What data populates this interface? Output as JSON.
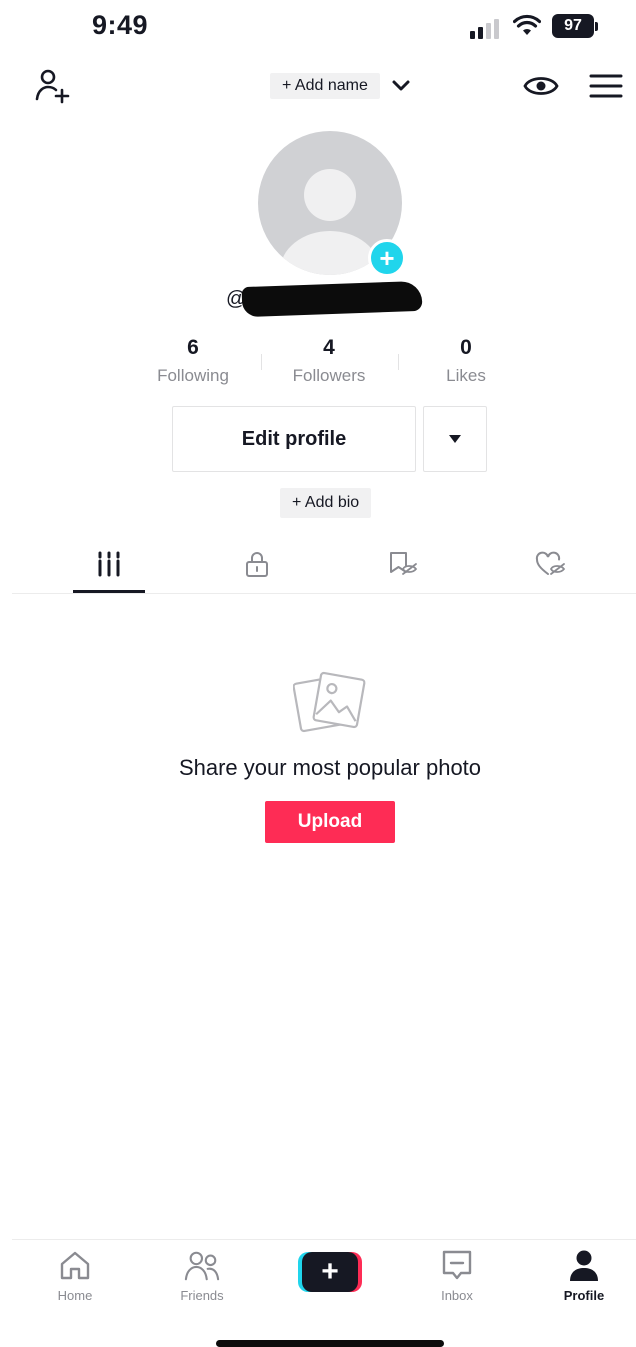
{
  "status_bar": {
    "time": "9:49",
    "battery": "97"
  },
  "header": {
    "add_name_label": "+ Add name"
  },
  "profile": {
    "username_prefix": "@",
    "stats": [
      {
        "value": "6",
        "label": "Following"
      },
      {
        "value": "4",
        "label": "Followers"
      },
      {
        "value": "0",
        "label": "Likes"
      }
    ],
    "edit_profile_label": "Edit profile",
    "add_bio_label": "+ Add bio"
  },
  "tabs": [
    {
      "icon": "grid-icon",
      "active": true
    },
    {
      "icon": "lock-icon",
      "active": false
    },
    {
      "icon": "bookmark-hidden-icon",
      "active": false
    },
    {
      "icon": "heart-hidden-icon",
      "active": false
    }
  ],
  "empty_state": {
    "icon": "photo-icon",
    "text": "Share your most popular photo",
    "upload_label": "Upload"
  },
  "bottom_nav": {
    "items": [
      {
        "label": "Home",
        "icon": "home-icon"
      },
      {
        "label": "Friends",
        "icon": "friends-icon"
      },
      {
        "label": "",
        "icon": "plus-icon"
      },
      {
        "label": "Inbox",
        "icon": "inbox-icon"
      },
      {
        "label": "Profile",
        "icon": "profile-icon"
      }
    ],
    "active": "Profile"
  },
  "colors": {
    "accent": "#fe2c55",
    "cyan": "#20d5ec",
    "text": "#161823",
    "muted": "#8a8b91"
  }
}
